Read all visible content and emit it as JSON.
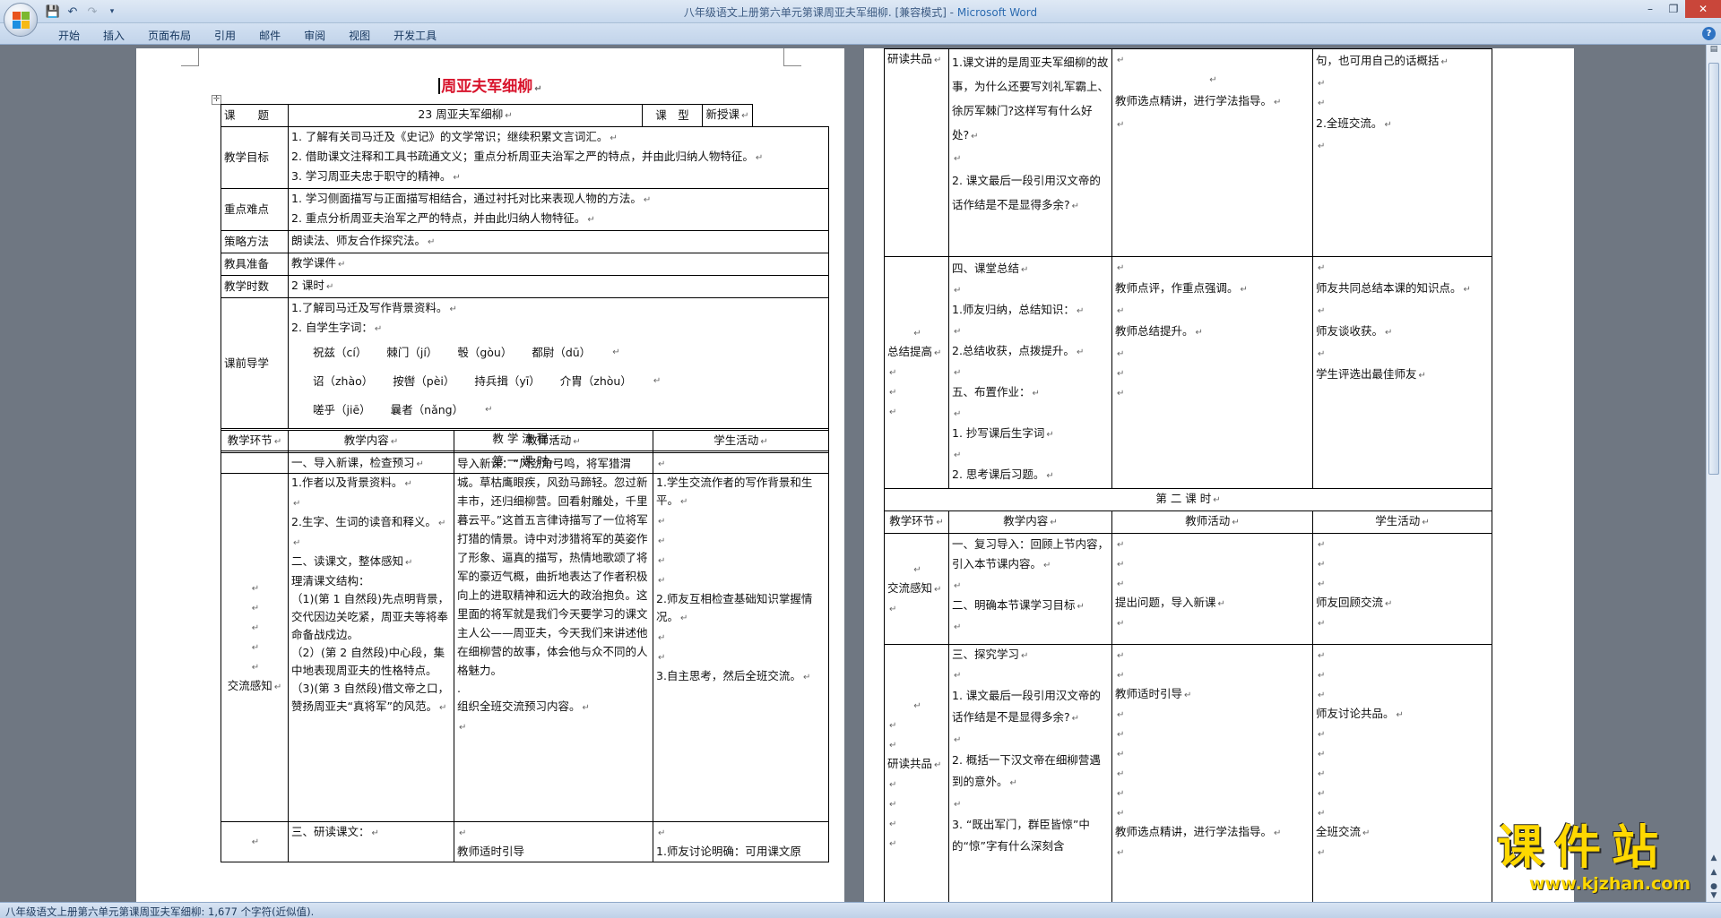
{
  "window": {
    "title_doc": "八年级语文上册第六单元第课周亚夫军细柳. [兼容模式] - ",
    "title_app": "Microsoft Word"
  },
  "ribbon": {
    "tabs": [
      "开始",
      "插入",
      "页面布局",
      "引用",
      "邮件",
      "审阅",
      "视图",
      "开发工具"
    ]
  },
  "status": {
    "text": "八年级语文上册第六单元第课周亚夫军细柳: 1,677 个字符(近似值)."
  },
  "watermark": {
    "title": "课件站",
    "url": "www.kjzhan.com"
  },
  "doc": {
    "title": "周亚夫军细柳",
    "info": {
      "course_label": "课　　题",
      "course_value": "23 周亚夫军细柳",
      "type_label": "课　型",
      "type_value": "新授课",
      "goal_label": "教学目标",
      "goals": [
        "1. 了解有关司马迁及《史记》的文学常识；继续积累文言词汇。",
        "2. 借助课文注释和工具书疏通文义；重点分析周亚夫治军之严的特点，并由此归纳人物特征。",
        "3. 学习周亚夫忠于职守的精神。"
      ],
      "key_label": "重点难点",
      "keys": [
        "1. 学习侧面描写与正面描写相结合，通过衬托对比来表现人物的方法。",
        "2. 重点分析周亚夫治军之严的特点，并由此归纳人物特征。"
      ],
      "method_label": "策略方法",
      "method_value": "朗读法、师友合作探究法。",
      "tool_label": "教具准备",
      "tool_value": "教学课件",
      "hours_label": "教学时数",
      "hours_value": "2 课时",
      "pre_label": "课前导学",
      "pre_1": "1.了解司马迁及写作背景资料。",
      "pre_2": "2. 自学生字词：",
      "pinyin": [
        [
          "祝兹（cí）",
          "棘门（jí）",
          "彀（gòu）",
          "都尉（dū）"
        ],
        [
          "诏（zhào）",
          "按辔（pèi）",
          "持兵揖（yī）",
          "介胄（zhòu）"
        ],
        [
          "嗟乎（jiē）",
          "曩者（nǎng）"
        ]
      ]
    },
    "flow": {
      "title": "教 学 流 程",
      "period1": "第 一 课 时",
      "period2": "第 二 课 时",
      "headers": [
        "教学环节",
        "教学内容",
        "教师活动",
        "学生活动"
      ]
    },
    "p1_row1": {
      "stage": "交流感知",
      "content": [
        "一、导入新课，检查预习",
        "1.作者以及背景资料。",
        "",
        "2.生字、生词的读音和释义。",
        "",
        "二、读课文，整体感知",
        "理清课文结构：",
        "（1)(第 1 自然段)先点明背景，交代因边关吃紧，周亚夫等将奉命备战戍边。",
        "（2）(第 2 自然段)中心段，集中地表现周亚夫的性格特点。",
        "（3)(第 3 自然段)借文帝之口，赞扬周亚夫“真将军”的风范。"
      ],
      "teacher": [
        "导入新课：“风劲角弓鸣，将军猎渭城。草枯鹰眼疾，风劲马蹄轻。忽过新丰市，还归细柳营。回看射雕处，千里暮云平。”这首五言律诗描写了一位将军打猎的情景。诗中对涉猎将军的英姿作了形象、逼真的描写，热情地歌颂了将军的豪迈气概，曲折地表达了作者积极向上的进取精神和远大的政治抱负。这里面的将军就是我们今天要学习的课文主人公——周亚夫，今天我们来讲述他在细柳营的故事，体会他与众不同的人格魅力。",
        ".",
        "组织全班交流预习内容。"
      ],
      "student": [
        "",
        "1.学生交流作者的写作背景和生平。",
        "",
        "",
        "",
        "",
        "2.师友互相检查基础知识掌握情况。",
        "",
        "",
        "3.自主思考，然后全班交流。"
      ]
    },
    "p1_row2": {
      "content": "三、研读课文：",
      "teacher": "教师适时引导",
      "student": "1.师友讨论明确：可用课文原"
    },
    "p2_row1": {
      "stage": "研读共品",
      "content": [
        "1.课文讲的是周亚夫军细柳的故事，为什么还要写刘礼军霸上、徐厉军棘门?这样写有什么好处?",
        "",
        "2. 课文最后一段引用汉文帝的话作结是不是显得多余?"
      ],
      "teacher": "教师选点精讲，进行学法指导。",
      "student": [
        "句，也可用自己的话概括",
        "",
        "",
        "2.全班交流。"
      ]
    },
    "p2_row2": {
      "stage": "总结提高",
      "content": [
        "四、课堂总结",
        "1.师友归纳，总结知识：",
        "2.总结收获，点拨提升。",
        "五、布置作业：",
        "1. 抄写课后生字词",
        "2. 思考课后习题。"
      ],
      "teacher": [
        "教师点评，作重点强调。",
        "教师总结提升。"
      ],
      "student": [
        "师友共同总结本课的知识点。",
        "师友谈收获。",
        "学生评选出最佳师友"
      ]
    },
    "p2_row3": {
      "stage": "交流感知",
      "content": [
        "一、复习导入：回顾上节内容，引入本节课内容。",
        "二、明确本节课学习目标"
      ],
      "teacher": "提出问题，导入新课",
      "student": "师友回顾交流"
    },
    "p2_row4": {
      "stage": "研读共品",
      "content": [
        "三、探究学习",
        "1. 课文最后一段引用汉文帝的话作结是不是显得多余?",
        "2. 概括一下汉文帝在细柳营遇到的意外。",
        "3. “既出军门，群臣皆惊”中的“惊”字有什么深刻含"
      ],
      "teacher": [
        "教师适时引导",
        "教师选点精讲，进行学法指导。"
      ],
      "student": [
        "师友讨论共品。",
        "全班交流"
      ]
    }
  }
}
